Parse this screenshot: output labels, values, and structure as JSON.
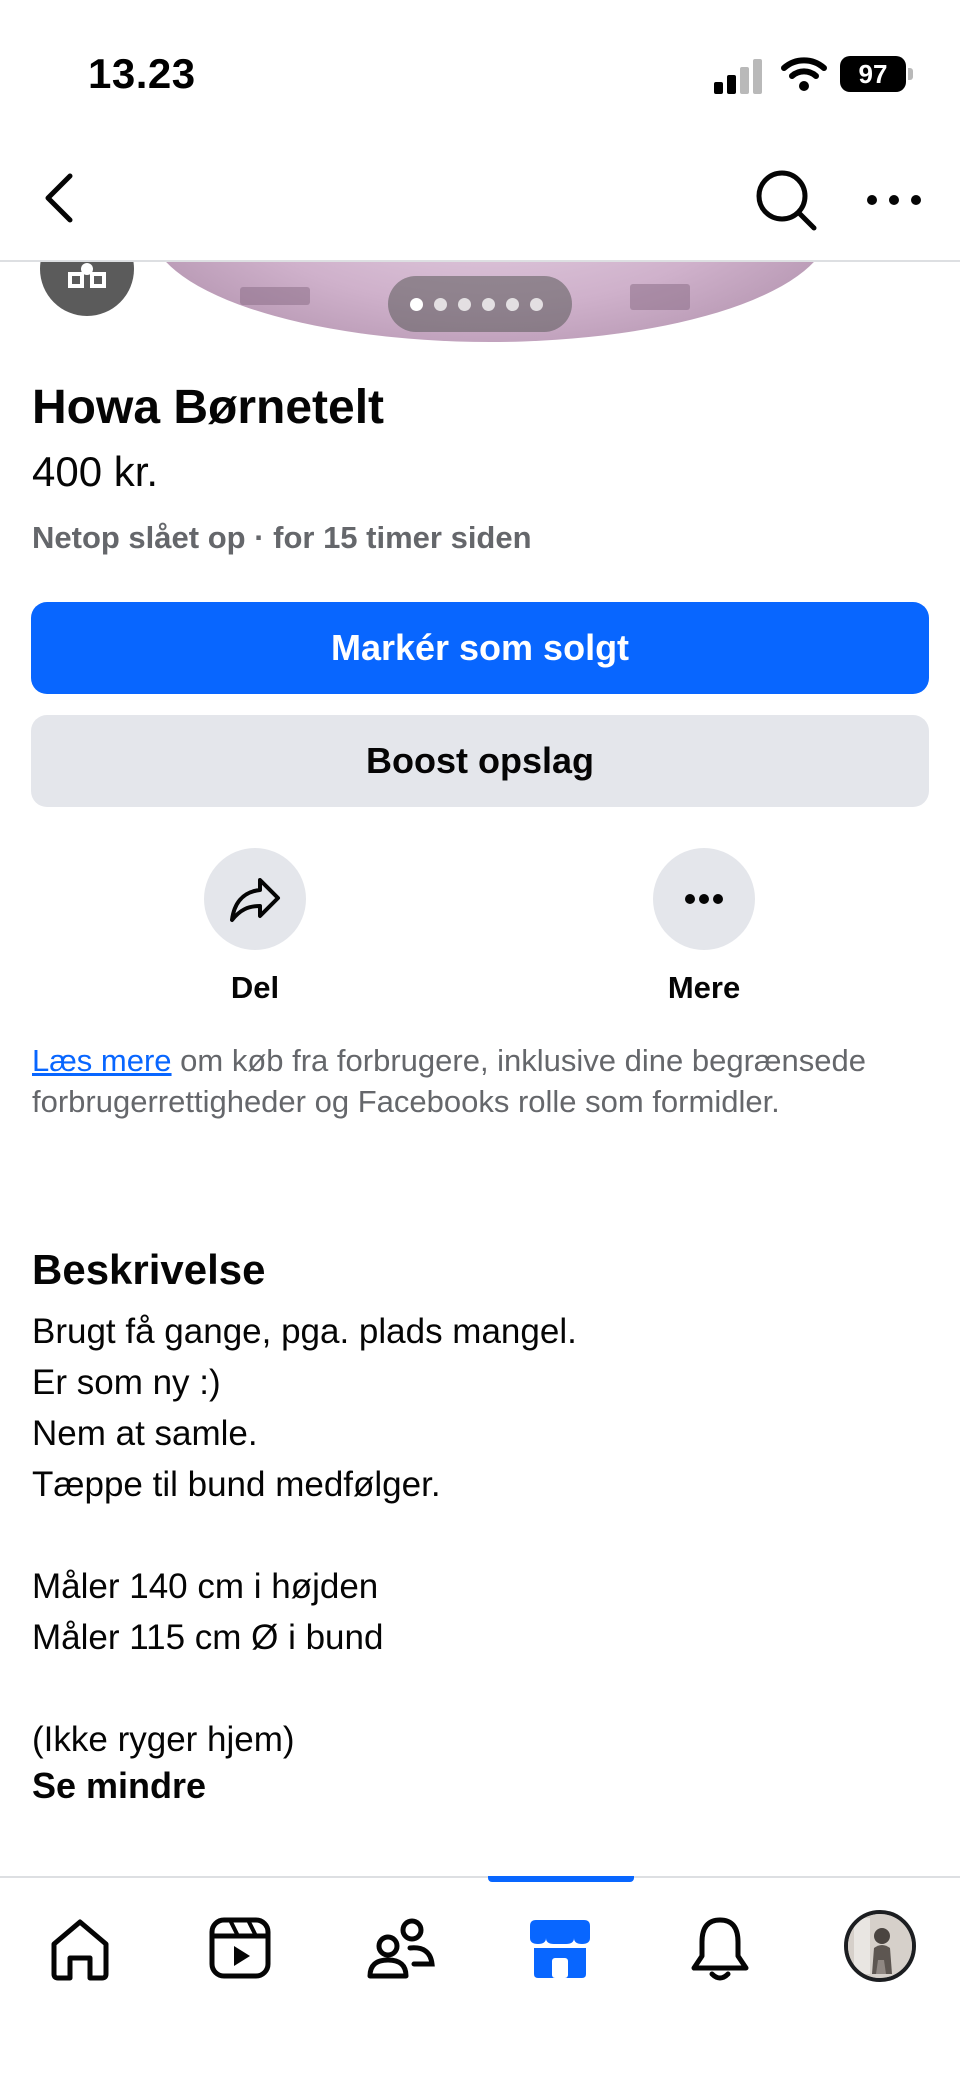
{
  "status_bar": {
    "time": "13.23",
    "battery": "97"
  },
  "nav": {
    "back_icon": "chevron-left-icon",
    "search_icon": "search-icon",
    "more_icon": "more-horizontal-icon"
  },
  "gallery": {
    "photo_count": 6,
    "active_index": 0
  },
  "listing": {
    "title": "Howa Børnetelt",
    "price": "400 kr.",
    "meta": "Netop slået op · for 15 timer siden"
  },
  "buttons": {
    "mark_sold": "Markér som solgt",
    "boost": "Boost opslag"
  },
  "actions": {
    "share_label": "Del",
    "more_label": "Mere"
  },
  "info": {
    "link_text": "Læs mere",
    "text": " om køb fra forbrugere, inklusive dine begrænsede forbrugerrettigheder og Facebooks rolle som formidler."
  },
  "description": {
    "heading": "Beskrivelse",
    "lines": [
      "Brugt få gange, pga. plads mangel.",
      "Er som ny :)",
      "Nem at samle.",
      "Tæppe til bund medfølger.",
      "",
      "Måler 140 cm i højden",
      "Måler 115 cm Ø i bund",
      "",
      "(Ikke ryger hjem)"
    ],
    "see_less": "Se mindre"
  },
  "tab_bar": {
    "active": "marketplace",
    "tabs": [
      "home-icon",
      "video-icon",
      "friends-icon",
      "marketplace-icon",
      "notifications-icon",
      "profile-avatar"
    ]
  },
  "colors": {
    "accent": "#0866ff",
    "secondary_button": "#e4e6eb",
    "muted_text": "#65676b"
  }
}
